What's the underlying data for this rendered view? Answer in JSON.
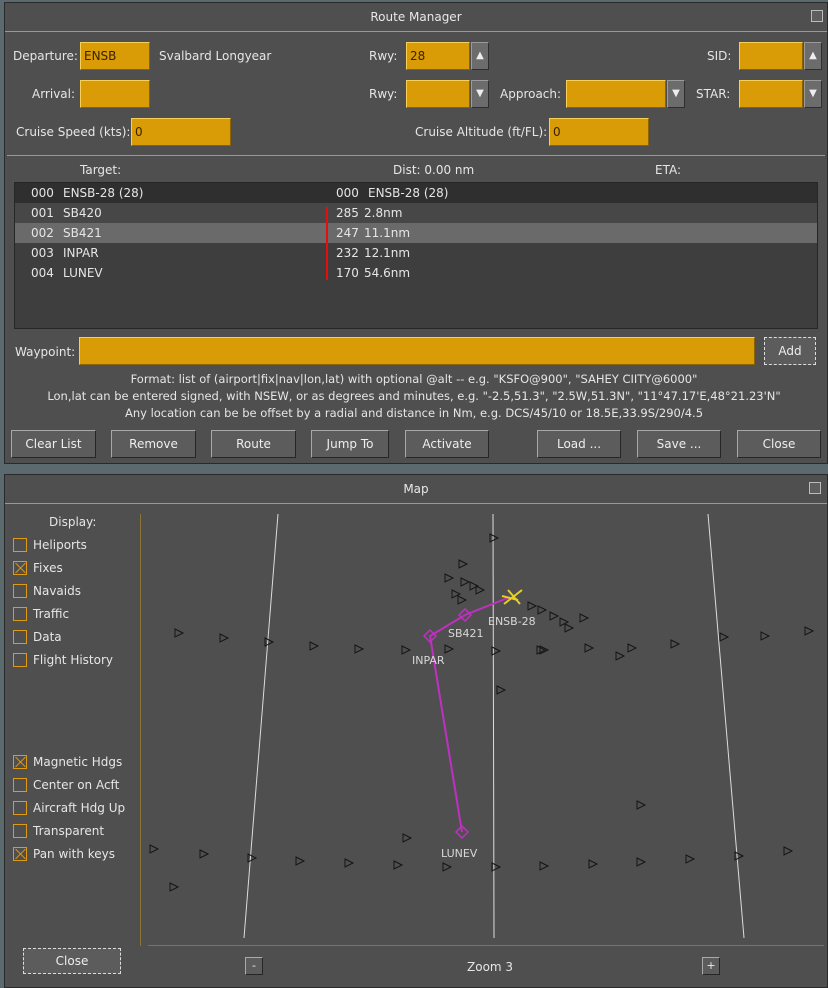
{
  "route_manager": {
    "title": "Route Manager",
    "departure": {
      "label": "Departure:",
      "code": "ENSB",
      "name": "Svalbard Longyear"
    },
    "rwy_label": "Rwy:",
    "departure_rwy": "28",
    "sid_label": "SID:",
    "sid_value": "",
    "arrival": {
      "label": "Arrival:",
      "code": ""
    },
    "arrival_rwy": "",
    "approach_label": "Approach:",
    "approach_value": "",
    "star_label": "STAR:",
    "star_value": "",
    "cruise_speed": {
      "label": "Cruise Speed (kts):",
      "value": "0"
    },
    "cruise_alt": {
      "label": "Cruise Altitude (ft/FL):",
      "value": "0"
    },
    "list_header": {
      "target": "Target:",
      "dist": "Dist: 0.00 nm",
      "eta": "ETA:"
    },
    "waypoints": [
      {
        "idx": "000",
        "name": "ENSB-28 (28)",
        "hdg": "000",
        "dist": "ENSB-28 (28)"
      },
      {
        "idx": "001",
        "name": "SB420",
        "hdg": "285",
        "dist": "2.8nm"
      },
      {
        "idx": "002",
        "name": "SB421",
        "hdg": "247",
        "dist": "11.1nm"
      },
      {
        "idx": "003",
        "name": "INPAR",
        "hdg": "232",
        "dist": "12.1nm"
      },
      {
        "idx": "004",
        "name": "LUNEV",
        "hdg": "170",
        "dist": "54.6nm"
      }
    ],
    "waypoint_label": "Waypoint:",
    "waypoint_value": "",
    "add_label": "Add",
    "hints": [
      "Format: list of (airport|fix|nav|lon,lat) with optional @alt -- e.g. \"KSFO@900\", \"SAHEY CIITY@6000\"",
      "Lon,lat can be entered signed, with NSEW, or as degrees and minutes, e.g. \"-2.5,51.3\", \"2.5W,51.3N\", \"11°47.17'E,48°21.23'N\"",
      "Any location can be be offset by a radial and distance in Nm, e.g. DCS/45/10 or 18.5E,33.9S/290/4.5"
    ],
    "buttons": {
      "clear_list": "Clear List",
      "remove": "Remove",
      "route": "Route",
      "jump_to": "Jump To",
      "activate": "Activate",
      "load": "Load ...",
      "save": "Save ...",
      "close": "Close"
    }
  },
  "map": {
    "title": "Map",
    "display_label": "Display:",
    "options_top": [
      {
        "label": "Heliports",
        "checked": false
      },
      {
        "label": "Fixes",
        "checked": true
      },
      {
        "label": "Navaids",
        "checked": false
      },
      {
        "label": "Traffic",
        "checked": false
      },
      {
        "label": "Data",
        "checked": false
      },
      {
        "label": "Flight History",
        "checked": false
      }
    ],
    "options_bottom": [
      {
        "label": "Magnetic Hdgs",
        "checked": true
      },
      {
        "label": "Center on Acft",
        "checked": false
      },
      {
        "label": "Aircraft Hdg Up",
        "checked": false
      },
      {
        "label": "Transparent",
        "checked": false
      },
      {
        "label": "Pan with keys",
        "checked": true
      }
    ],
    "close_label": "Close",
    "zoom_label": "Zoom 3",
    "zoom_out": "-",
    "zoom_in": "+",
    "labels": {
      "ensb": "ENSB-28",
      "sb421": "SB421",
      "inpar": "INPAR",
      "lunev": "LUNEV"
    },
    "colors": {
      "route": "#c030c0",
      "aircraft": "#e8d020",
      "accent": "#d99b06"
    }
  }
}
